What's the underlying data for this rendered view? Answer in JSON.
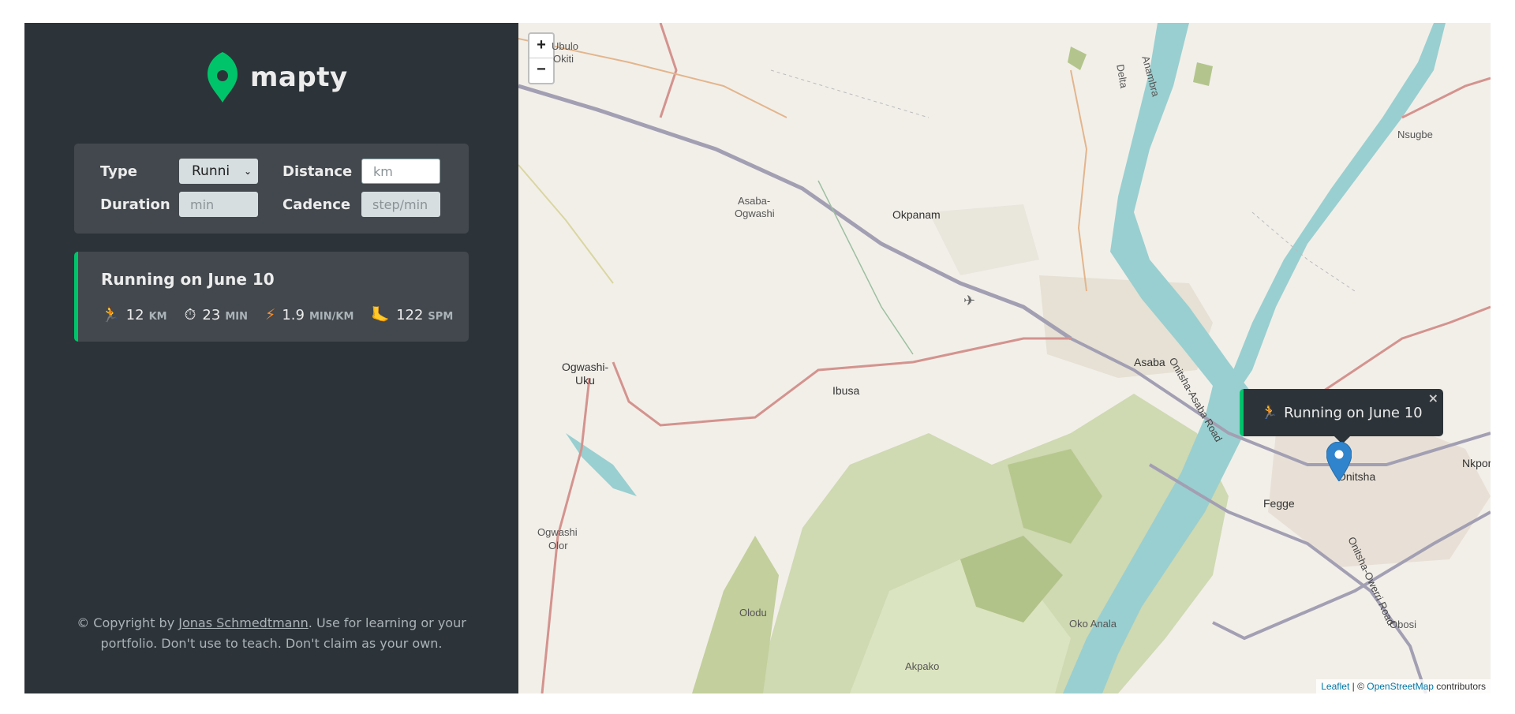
{
  "app": {
    "name": "mapty"
  },
  "form": {
    "type_label": "Type",
    "type_value": "Runni",
    "distance_label": "Distance",
    "distance_placeholder": "km",
    "duration_label": "Duration",
    "duration_placeholder": "min",
    "cadence_label": "Cadence",
    "cadence_placeholder": "step/min"
  },
  "workouts": [
    {
      "title": "Running on June 10",
      "distance": "12",
      "distance_unit": "KM",
      "duration": "23",
      "duration_unit": "MIN",
      "pace": "1.9",
      "pace_unit": "MIN/KM",
      "cadence": "122",
      "cadence_unit": "SPM"
    }
  ],
  "copyright": {
    "prefix": "© Copyright by ",
    "author": "Jonas Schmedtmann",
    "suffix": ". Use for learning or your portfolio. Don't use to teach. Don't claim as your own."
  },
  "map": {
    "zoom_in": "+",
    "zoom_out": "−",
    "popup_text": "Running on June 10",
    "popup_close": "×",
    "labels": {
      "ubulo": "Ubulo",
      "okiti": "Okiti",
      "asaba_ogwashi_1": "Asaba-",
      "asaba_ogwashi_2": "Ogwashi",
      "okpanam": "Okpanam",
      "ogwashi_uku_1": "Ogwashi-",
      "ogwashi_uku_2": "Uku",
      "ibusa": "Ibusa",
      "asaba": "Asaba",
      "onitsha": "Onitsha",
      "fegge": "Fegge",
      "nkpor": "Nkpor",
      "nsugbe": "Nsugbe",
      "ogwashi_olor_1": "Ogwashi",
      "ogwashi_olor_2": "Olor",
      "olodu": "Olodu",
      "akpako": "Akpako",
      "oko_anala": "Oko Anala",
      "obosi": "Obosi",
      "delta": "Delta",
      "anambra": "Anambra",
      "onitsha_asaba_road": "Onitsha-Asaba Road",
      "onitsha_owerri_road": "Onitsha-Owerri Road"
    },
    "attribution_leaflet": "Leaflet",
    "attribution_sep": " | © ",
    "attribution_osm": "OpenStreetMap",
    "attribution_suffix": " contributors"
  }
}
